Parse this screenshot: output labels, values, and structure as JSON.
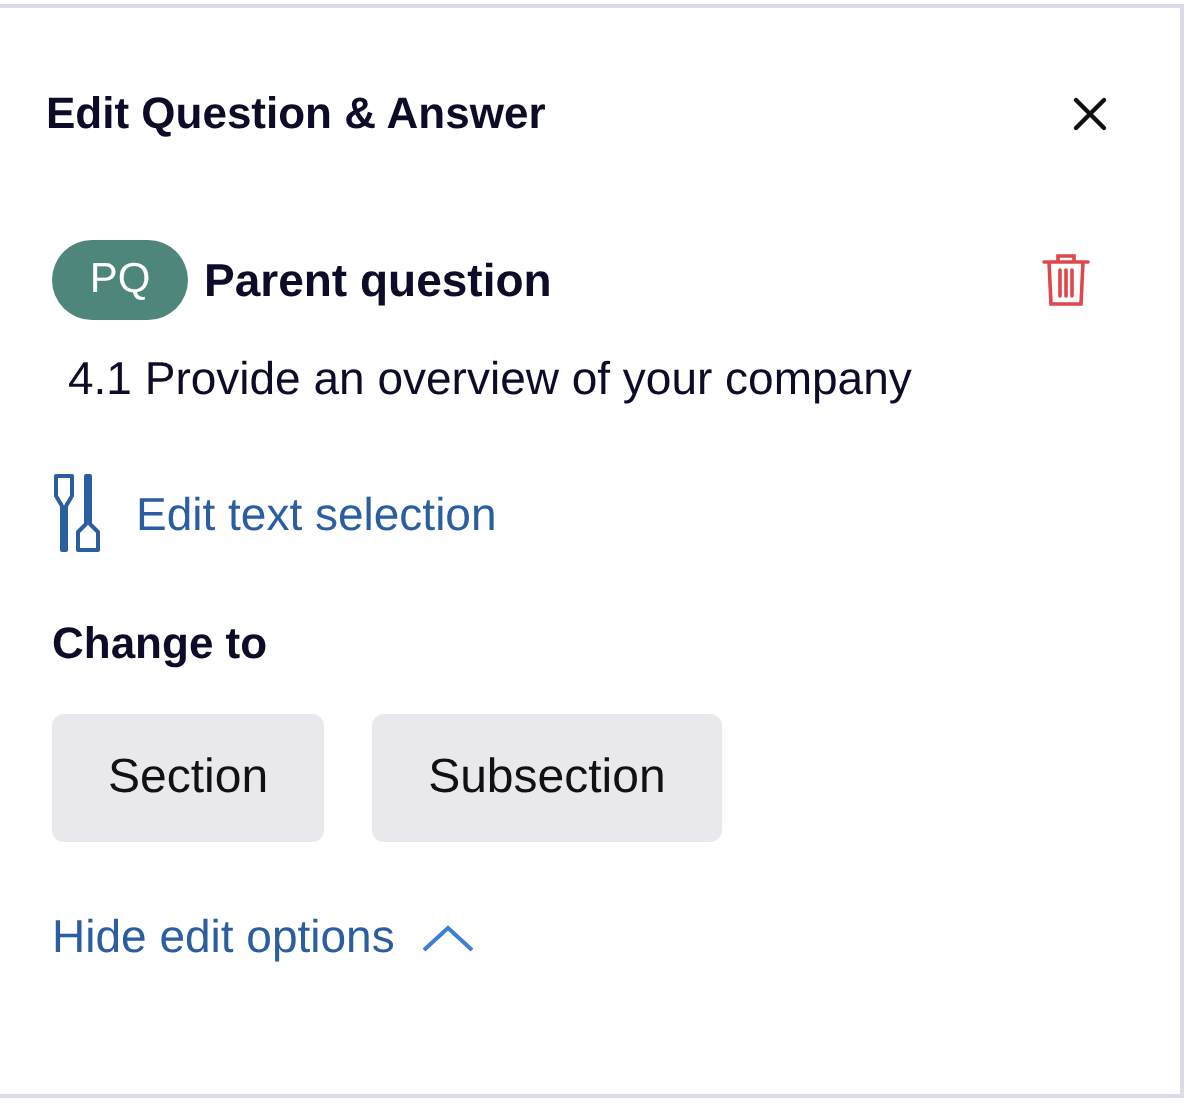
{
  "panel": {
    "title": "Edit Question & Answer"
  },
  "question": {
    "badge": "PQ",
    "type_label": "Parent question",
    "text": "4.1 Provide an overview of your company"
  },
  "edit_selection_link": "Edit text selection",
  "change_to": {
    "label": "Change to",
    "options": [
      "Section",
      "Subsection"
    ]
  },
  "toggle_link": {
    "label": "Hide edit options",
    "expanded": true
  }
}
